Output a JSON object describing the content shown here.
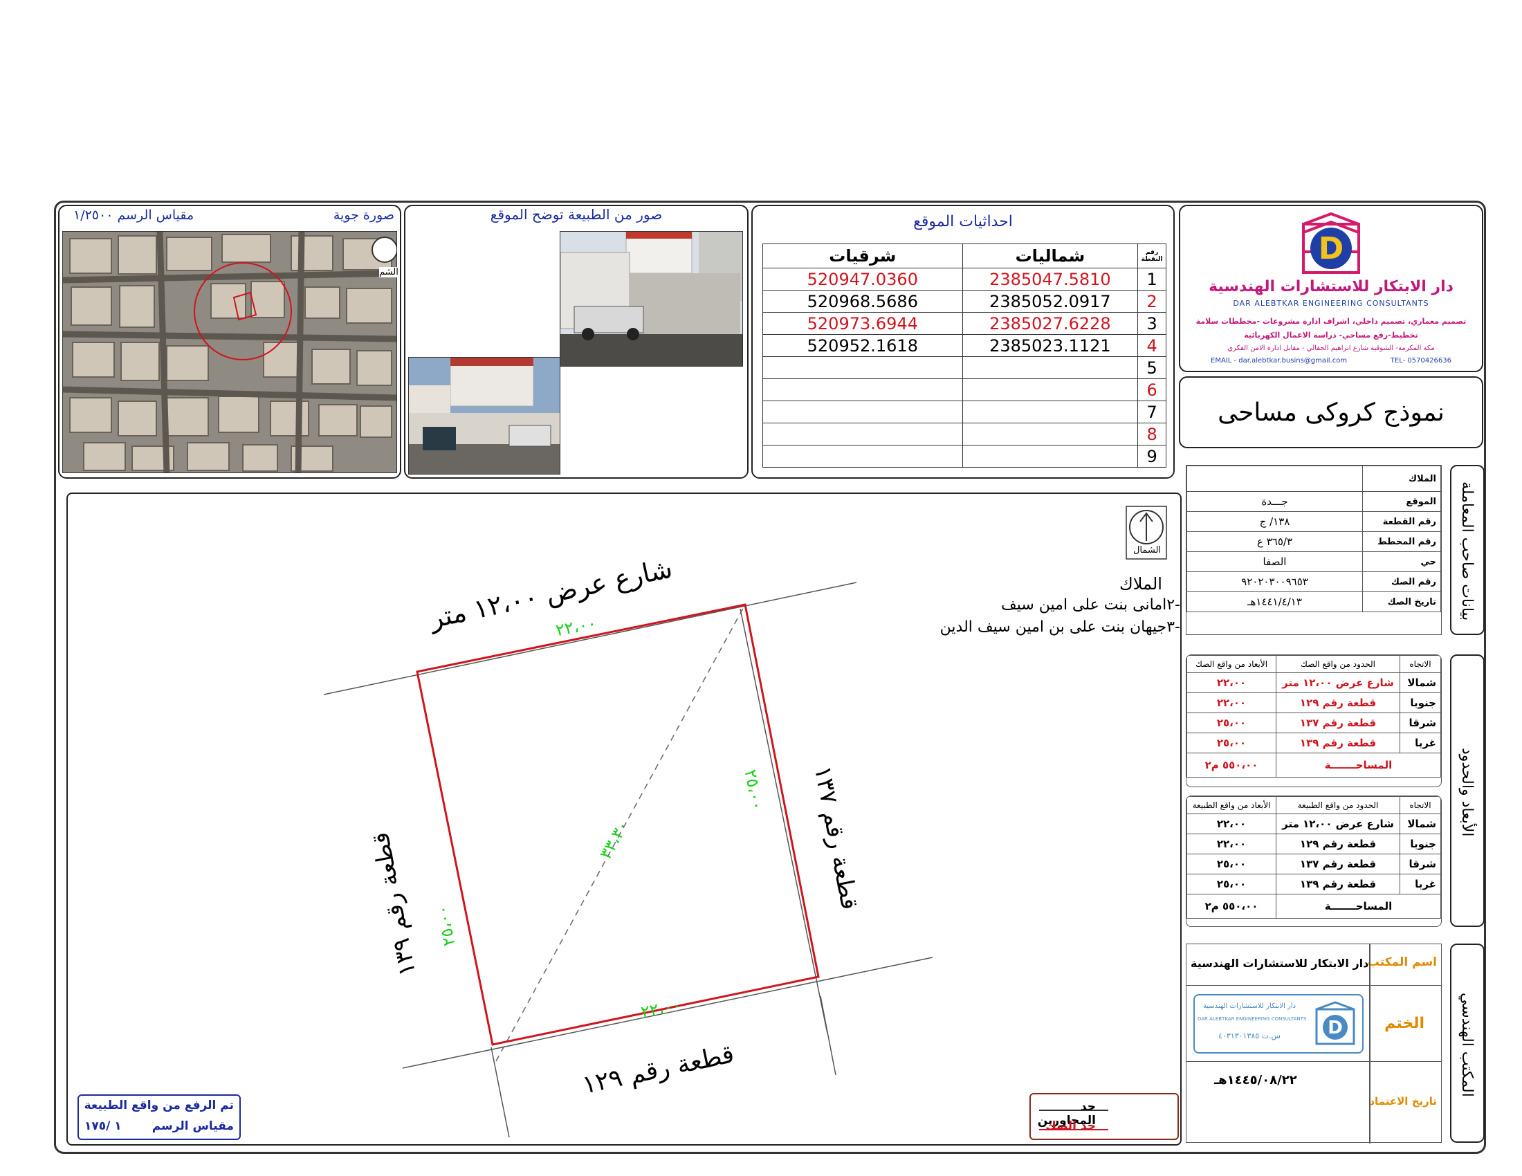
{
  "aerial": {
    "title": "صورة جوية",
    "scale": "مقياس الرسم ١/٢٥٠٠",
    "north_short": "الشم"
  },
  "photos": {
    "title": "صور من الطبيعة توضح الموقع"
  },
  "coordinates": {
    "title": "احداثيات الموقع",
    "headers": {
      "north": "شماليات",
      "east": "شرقيات",
      "num": "رقم النقطة"
    },
    "rows": [
      {
        "n": "1",
        "north": "2385047.5810",
        "east": "520947.0360"
      },
      {
        "n": "2",
        "north": "2385052.0917",
        "east": "520968.5686"
      },
      {
        "n": "3",
        "north": "2385027.6228",
        "east": "520973.6944"
      },
      {
        "n": "4",
        "north": "2385023.1121",
        "east": "520952.1618"
      },
      {
        "n": "5",
        "north": "",
        "east": ""
      },
      {
        "n": "6",
        "north": "",
        "east": ""
      },
      {
        "n": "7",
        "north": "",
        "east": ""
      },
      {
        "n": "8",
        "north": "",
        "east": ""
      },
      {
        "n": "9",
        "north": "",
        "east": ""
      }
    ]
  },
  "office": {
    "name_ar": "دار الابتكار للاستشارات الهندسية",
    "name_en": "DAR ALEBTKAR ENGINEERING CONSULTANTS",
    "line1": "تصميم معماري، تصميم داخلي، اشراف ادارة مشروعات -مخططات سلامة",
    "line2": "تخطيط-رفع مساحي- دراسة الاعمال الكهربائية",
    "line3": "مكة المكرمة- الشوقية شارع ابراهيم الجفالي - مقابل ادارة الامن الفكري",
    "email": "EMAIL - dar.alebtkar.busins@gmail.com",
    "tel": "TEL- 0570426636"
  },
  "form_title": "نموذج كروكى مساحى",
  "side_labels": {
    "owner_data": "بيانات صاحب المعاملة",
    "dims": "الأبعاد والحدود",
    "office": "المكتب الهندسي"
  },
  "info": {
    "rows": [
      {
        "label": "الملاك",
        "value": ""
      },
      {
        "label": "الموقع",
        "value": "جـــدة"
      },
      {
        "label": "رقم القطعة",
        "value": "١٣٨/ ج"
      },
      {
        "label": "رقم المخطط",
        "value": "٣٦٥/٣ ع"
      },
      {
        "label": "حي",
        "value": "الصفا"
      },
      {
        "label": "رقم الصك",
        "value": "٩٢٠٢٠٣٠٠٩٦٥٣"
      },
      {
        "label": "تاريخ الصك",
        "value": "١٤٤١/٤/١٣هـ"
      }
    ]
  },
  "deed_bounds": {
    "headers": {
      "dir": "الاتجاه",
      "bound": "الحدود من واقع الصك",
      "dim": "الأبعاد من واقع الصك"
    },
    "rows": [
      {
        "dir": "شمالا",
        "bound": "شارع عرض ١٢،٠٠ متر",
        "dim": "٢٢،٠٠"
      },
      {
        "dir": "جنوبا",
        "bound": "قطعة رقم ١٢٩",
        "dim": "٢٢،٠٠"
      },
      {
        "dir": "شرقا",
        "bound": "قطعة رقم ١٣٧",
        "dim": "٢٥،٠٠"
      },
      {
        "dir": "غربا",
        "bound": "قطعة رقم ١٣٩",
        "dim": "٢٥،٠٠"
      }
    ],
    "area_label": "المساحـــــــة",
    "area": "٥٥٠،٠٠ م٢"
  },
  "nature_bounds": {
    "headers": {
      "dir": "الاتجاه",
      "bound": "الحدود من واقع الطبيعة",
      "dim": "الأبعاد من واقع الطبيعة"
    },
    "rows": [
      {
        "dir": "شمالا",
        "bound": "شارع عرض ١٢،٠٠ متر",
        "dim": "٢٢،٠٠"
      },
      {
        "dir": "جنوبا",
        "bound": "قطعة رقم ١٢٩",
        "dim": "٢٢،٠٠"
      },
      {
        "dir": "شرقا",
        "bound": "قطعة رقم ١٣٧",
        "dim": "٢٥،٠٠"
      },
      {
        "dir": "غربا",
        "bound": "قطعة رقم ١٣٩",
        "dim": "٢٥،٠٠"
      }
    ],
    "area_label": "المساحـــــــة",
    "area": "٥٥٠،٠٠ م٢"
  },
  "office_block": {
    "name_label": "اسم المكتب",
    "name": "دار الابتكار للاستشارات الهندسية",
    "stamp_label": "الختم",
    "stamp_text": "دار الابتكار للاستشارات الهندسية",
    "stamp_en": "DAR ALEBTKAR ENGINEERING CONSULTANTS",
    "stamp_cr": "س.ت ٤٠٣١٣٠١٣٨٥",
    "date_label": "تاريخ الاعتماد",
    "date": "١٤٤٥/٠٨/٢٢هـ"
  },
  "drawing": {
    "north_label": "الشمال",
    "owners_title": "الملاك",
    "owner_2": "-٢امانى بنت على امين سيف",
    "owner_3": "-٣جيهان بنت على بن امين سيف الدين",
    "street": "شارع عرض ١٢،٠٠ متر",
    "plot_east": "قطعة رقم ١٣٧",
    "plot_west": "قطعة رقم ١٣٩",
    "plot_south": "قطعة رقم ١٢٩",
    "dim_north": "٢٢،٠٠",
    "dim_south": "٢٢،٠٠",
    "dim_east": "٢٥،٠٠",
    "dim_west": "٢٥،٠٠",
    "diagonal": "٣٣،٣٠",
    "survey_note": "تم الرفع من واقع الطبيعة",
    "scale_label": "مقياس الرسم",
    "scale_value": "١ /١٧٥",
    "legend_neighbors": "حد المجاورين",
    "legend_deed": "حد الصك"
  },
  "colors": {
    "deed_red": "#d0141e",
    "dims_green": "#18d018",
    "blue": "#1a2aa0",
    "orange": "#e08a00"
  }
}
